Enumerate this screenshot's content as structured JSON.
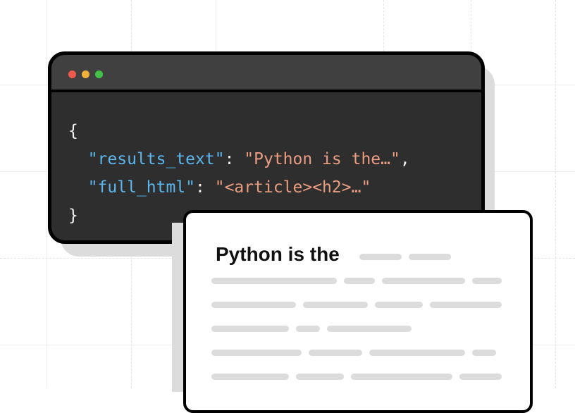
{
  "code_window": {
    "line_open": "{",
    "line1": {
      "key": "\"results_text\"",
      "sep": ": ",
      "value": "\"Python is the…\"",
      "end": ","
    },
    "line2": {
      "key": "\"full_html\"",
      "sep": ": ",
      "value": "\"<article><h2>…\""
    },
    "line_close": "}"
  },
  "article_card": {
    "headline": "Python is the"
  },
  "colors": {
    "key": "#5cb6ee",
    "string": "#e99c80",
    "window_bg": "#2e2e2e",
    "dot_red": "#ef5a4e",
    "dot_yellow": "#f2b13a",
    "dot_green": "#43c14b"
  }
}
